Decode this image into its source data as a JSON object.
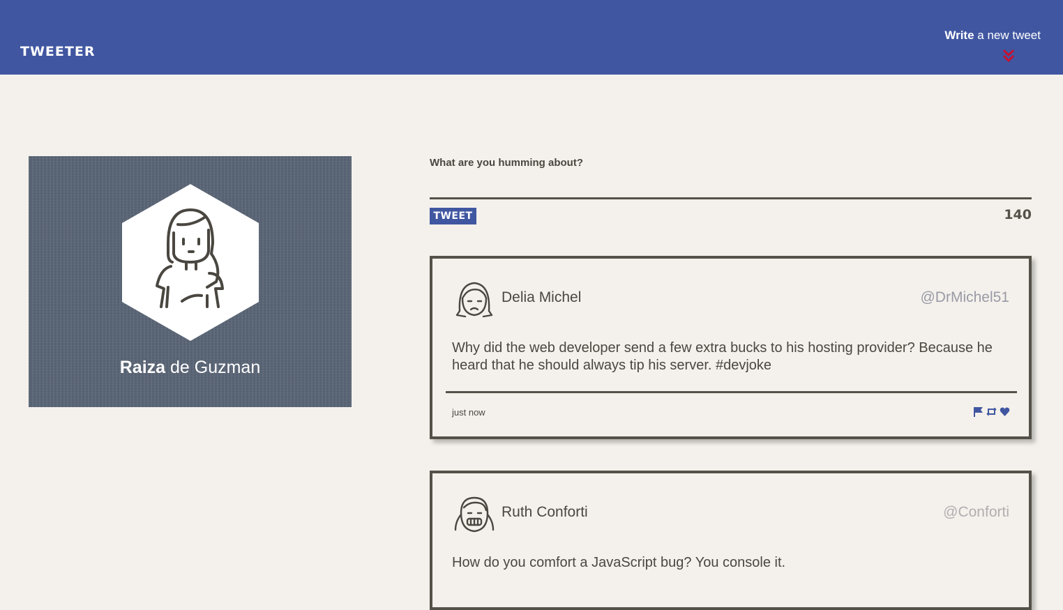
{
  "nav": {
    "brand": "TWEETER",
    "compose_bold": "Write",
    "compose_rest": " a new tweet",
    "chevron_icon": "double-chevron-down-icon",
    "chevron_color": "#c8102e"
  },
  "profile": {
    "first_name": "Raiza",
    "last_name": " de Guzman",
    "avatar_icon": "girl-avatar-icon"
  },
  "compose": {
    "question": "What are you humming about?",
    "textarea_value": "",
    "button_label": "TWEET",
    "counter": "140"
  },
  "tweets": [
    {
      "name": "Delia Michel",
      "handle": "@DrMichel51",
      "text": "Why did the web developer send a few extra bucks to his hosting provider? Because he heard that he should always tip his server. #devjoke",
      "time": "just now",
      "avatar_icon": "sad-girl-avatar-icon"
    },
    {
      "name": "Ruth Conforti",
      "handle": "@Conforti",
      "text": "How do you comfort a JavaScript bug? You console it.",
      "time": "",
      "avatar_icon": "grinning-girl-avatar-icon"
    }
  ],
  "actions": [
    "flag-icon",
    "retweet-icon",
    "heart-icon"
  ],
  "colors": {
    "nav_bg": "#4056a1",
    "page_bg": "#f4f1ec",
    "border": "#545149",
    "accent": "#4056a1"
  }
}
